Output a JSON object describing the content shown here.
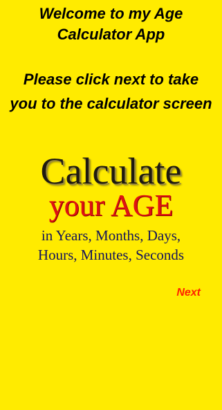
{
  "welcome": {
    "text": "Welcome to my Age Calculator App"
  },
  "instructions": {
    "text": "Please click next to take you to the calculator screen"
  },
  "graphic": {
    "line1": "Calculate",
    "line2": "your AGE",
    "line3": "in Years, Months, Days,",
    "line4": "Hours, Minutes, Seconds"
  },
  "actions": {
    "next_label": "Next"
  },
  "colors": {
    "background": "#FFEB00",
    "text": "#000000",
    "next": "#FF2200",
    "age": "#E01212",
    "units": "#14145C"
  }
}
